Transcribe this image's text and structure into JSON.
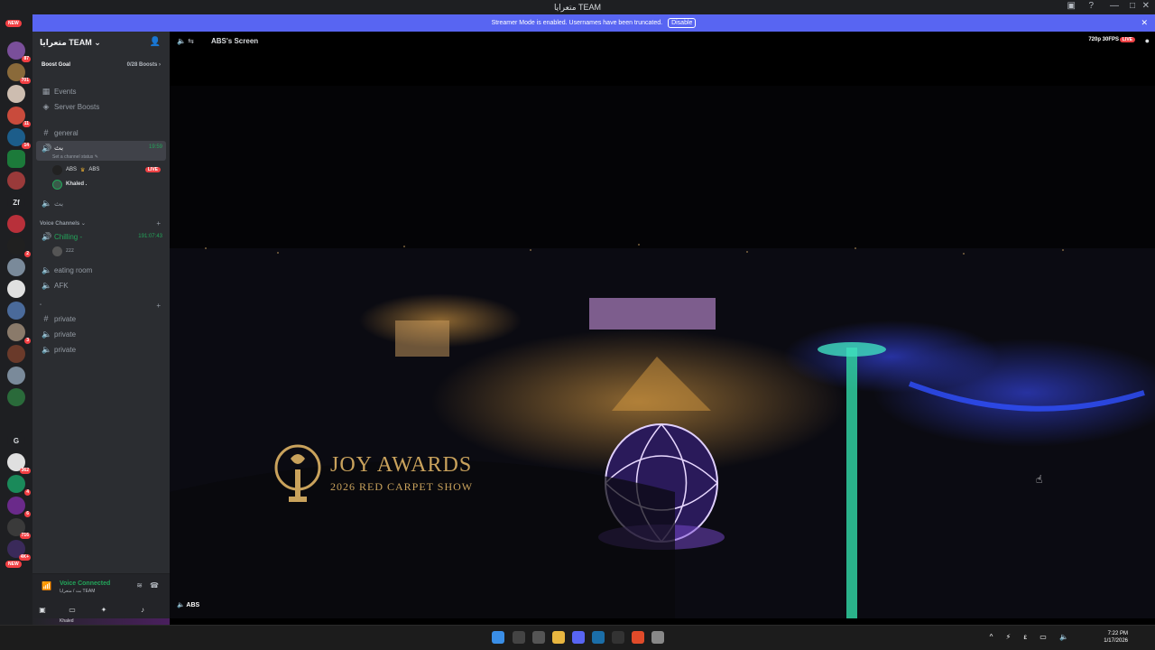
{
  "window": {
    "title": "متعرايا TEAM"
  },
  "banner": {
    "text": "Streamer Mode is enabled. Usernames have been truncated.",
    "button": "Disable"
  },
  "rail": {
    "new_top": "NEW",
    "new_bottom": "NEW",
    "letter_servers": [
      "Zf",
      "G"
    ],
    "badges": [
      "87",
      "701",
      "11",
      "14",
      "2",
      "3",
      "362",
      "4",
      "6",
      "716",
      "4K+"
    ]
  },
  "server": {
    "name": "متعرايا TEAM",
    "boost_goal_label": "Boost Goal",
    "boost_goal_value": "0/28 Boosts"
  },
  "channels": {
    "events": "Events",
    "server_boosts": "Server Boosts",
    "general": "general",
    "voice_active": {
      "name": "بث",
      "time": "19:59",
      "status_hint": "Set a channel status"
    },
    "voice_users": [
      {
        "name": "ABS",
        "tag": "ABS",
        "live": "LIVE"
      },
      {
        "name": "Khaled ."
      }
    ],
    "voice_2": "بث",
    "category_voice": "Voice Channels",
    "chilling": {
      "name": "Chilling -",
      "time": "191:07:43"
    },
    "chilling_user": "zzz",
    "eating_room": "eating room",
    "afk": "AFK",
    "category_dash": "-",
    "private": [
      "private",
      "private",
      "private"
    ]
  },
  "voice_panel": {
    "status": "Voice Connected",
    "location": "بث / متعرايا TEAM"
  },
  "user_panel": {
    "name": "Khaled"
  },
  "stream": {
    "channel_name": "ABS's Screen",
    "quality": "720p 30FPS",
    "live": "LIVE",
    "bottom_name": "ABS",
    "overlay_title": "JOY AWARDS",
    "overlay_subtitle": "2026 RED CARPET SHOW"
  },
  "taskbar": {
    "time": "7:22 PM",
    "date": "1/17/2026"
  },
  "colors": {
    "accent": "#5865f2",
    "live": "#ed4245",
    "online": "#23a55a"
  }
}
